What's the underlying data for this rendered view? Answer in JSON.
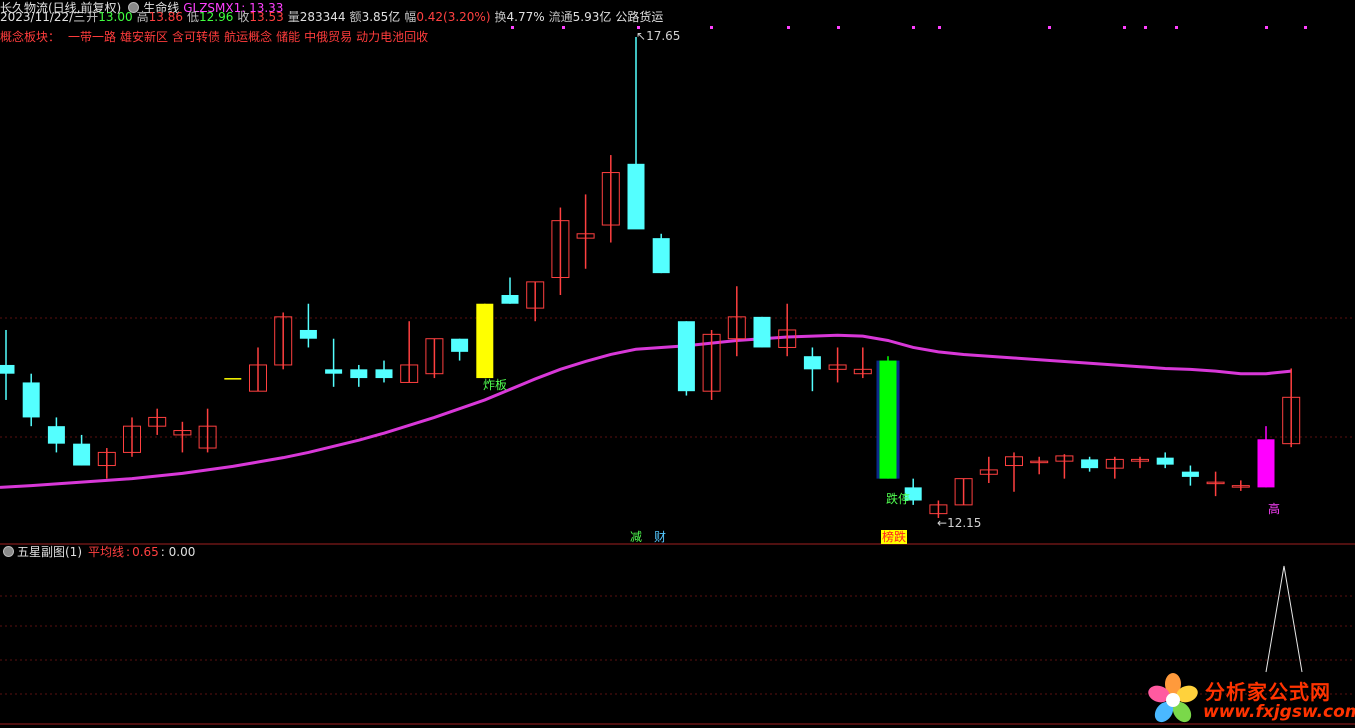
{
  "header": {
    "stock_name": "长久物流(日线,前复权)",
    "indicator_name": "生命线",
    "indicator_value_label": "GLZSMX1: 13.33",
    "date": "2023/11/22/三",
    "open_label": "开",
    "open_value": "13.00",
    "high_label": "高",
    "high_value": "13.86",
    "low_label": "低",
    "low_value": "12.96",
    "close_label": "收",
    "close_value": "13.53",
    "volume_label": "量",
    "volume_value": "283344",
    "amount_label": "额",
    "amount_value": "3.85亿",
    "change_label": "幅",
    "change_value": "0.42(3.20%)",
    "turnover_label": "换",
    "turnover_value": "4.77%",
    "float_label": "流通",
    "float_value": "5.93亿",
    "sector": "公路货运"
  },
  "concepts": {
    "label": "概念板块：",
    "items": [
      "一带一路",
      "雄安新区",
      "含可转债",
      "航运概念",
      "储能",
      "中俄贸易",
      "动力电池回收"
    ]
  },
  "annotations": {
    "high_price": "17.65",
    "low_price": "12.15",
    "zhaban": "炸板",
    "dieting": "跌停",
    "jian": "减",
    "cai": "财",
    "bangdie": "榜跌",
    "gao": "高"
  },
  "sub_chart": {
    "title": "五星副图(1)",
    "ma_label": "平均线",
    "ma_value": "0.65",
    "value2": ": 0.00"
  },
  "logo": {
    "title": "分析家公式网",
    "url": "www.fxjgsw.com"
  },
  "colors": {
    "up": "#ff4040",
    "down": "#54ffff",
    "ma_line": "#d838d8",
    "limit_up": "#ffff00",
    "limit_down": "#00ff00",
    "gao_candle": "#ff00ff"
  },
  "chart_data": {
    "type": "candlestick",
    "candles": [
      {
        "o": 13.9,
        "h": 14.3,
        "l": 13.5,
        "c": 13.8
      },
      {
        "o": 13.7,
        "h": 13.8,
        "l": 13.2,
        "c": 13.3
      },
      {
        "o": 13.2,
        "h": 13.3,
        "l": 12.9,
        "c": 13.0
      },
      {
        "o": 13.0,
        "h": 13.1,
        "l": 12.75,
        "c": 12.75
      },
      {
        "o": 12.75,
        "h": 12.95,
        "l": 12.6,
        "c": 12.9
      },
      {
        "o": 12.9,
        "h": 13.3,
        "l": 12.85,
        "c": 13.2
      },
      {
        "o": 13.2,
        "h": 13.4,
        "l": 13.1,
        "c": 13.3
      },
      {
        "o": 13.1,
        "h": 13.25,
        "l": 12.9,
        "c": 13.15
      },
      {
        "o": 12.95,
        "h": 13.4,
        "l": 12.9,
        "c": 13.2
      },
      {
        "o": 13.75,
        "h": 13.75,
        "l": 13.75,
        "c": 13.75,
        "color": "limit_up"
      },
      {
        "o": 13.6,
        "h": 14.1,
        "l": 13.6,
        "c": 13.9
      },
      {
        "o": 13.9,
        "h": 14.5,
        "l": 13.85,
        "c": 14.45
      },
      {
        "o": 14.3,
        "h": 14.6,
        "l": 14.1,
        "c": 14.2
      },
      {
        "o": 13.85,
        "h": 14.2,
        "l": 13.65,
        "c": 13.8
      },
      {
        "o": 13.85,
        "h": 13.9,
        "l": 13.65,
        "c": 13.75
      },
      {
        "o": 13.85,
        "h": 13.95,
        "l": 13.7,
        "c": 13.75
      },
      {
        "o": 13.7,
        "h": 14.4,
        "l": 13.7,
        "c": 13.9
      },
      {
        "o": 13.8,
        "h": 14.2,
        "l": 13.75,
        "c": 14.2
      },
      {
        "o": 14.2,
        "h": 14.2,
        "l": 13.95,
        "c": 14.05
      },
      {
        "o": 14.6,
        "h": 14.6,
        "l": 13.75,
        "c": 13.75,
        "color": "limit_up",
        "wick": "limit_up"
      },
      {
        "o": 14.7,
        "h": 14.9,
        "l": 14.6,
        "c": 14.6
      },
      {
        "o": 14.55,
        "h": 14.85,
        "l": 14.4,
        "c": 14.85
      },
      {
        "o": 14.9,
        "h": 15.7,
        "l": 14.7,
        "c": 15.55
      },
      {
        "o": 15.35,
        "h": 15.85,
        "l": 15.0,
        "c": 15.4
      },
      {
        "o": 15.5,
        "h": 16.3,
        "l": 15.3,
        "c": 16.1
      },
      {
        "o": 16.2,
        "h": 17.65,
        "l": 15.5,
        "c": 15.45
      },
      {
        "o": 15.35,
        "h": 15.4,
        "l": 14.95,
        "c": 14.95
      },
      {
        "o": 14.4,
        "h": 14.4,
        "l": 13.55,
        "c": 13.6
      },
      {
        "o": 13.6,
        "h": 14.3,
        "l": 13.5,
        "c": 14.25
      },
      {
        "o": 14.2,
        "h": 14.8,
        "l": 14.0,
        "c": 14.45
      },
      {
        "o": 14.45,
        "h": 14.45,
        "l": 14.1,
        "c": 14.1
      },
      {
        "o": 14.1,
        "h": 14.6,
        "l": 14.0,
        "c": 14.3
      },
      {
        "o": 14.0,
        "h": 14.1,
        "l": 13.6,
        "c": 13.85
      },
      {
        "o": 13.85,
        "h": 14.1,
        "l": 13.7,
        "c": 13.9
      },
      {
        "o": 13.8,
        "h": 14.1,
        "l": 13.75,
        "c": 13.85
      },
      {
        "o": 13.95,
        "h": 14.0,
        "l": 12.6,
        "c": 12.6,
        "color": "limit_down"
      },
      {
        "o": 12.5,
        "h": 12.6,
        "l": 12.3,
        "c": 12.35
      },
      {
        "o": 12.2,
        "h": 12.35,
        "l": 12.15,
        "c": 12.3
      },
      {
        "o": 12.3,
        "h": 12.6,
        "l": 12.3,
        "c": 12.6
      },
      {
        "o": 12.65,
        "h": 12.85,
        "l": 12.55,
        "c": 12.7
      },
      {
        "o": 12.75,
        "h": 12.9,
        "l": 12.45,
        "c": 12.85
      },
      {
        "o": 12.8,
        "h": 12.85,
        "l": 12.65,
        "c": 12.8
      },
      {
        "o": 12.8,
        "h": 12.88,
        "l": 12.6,
        "c": 12.86
      },
      {
        "o": 12.82,
        "h": 12.85,
        "l": 12.68,
        "c": 12.72
      },
      {
        "o": 12.72,
        "h": 12.85,
        "l": 12.6,
        "c": 12.82
      },
      {
        "o": 12.8,
        "h": 12.85,
        "l": 12.72,
        "c": 12.82
      },
      {
        "o": 12.84,
        "h": 12.9,
        "l": 12.72,
        "c": 12.76
      },
      {
        "o": 12.68,
        "h": 12.75,
        "l": 12.52,
        "c": 12.62
      },
      {
        "o": 12.56,
        "h": 12.68,
        "l": 12.4,
        "c": 12.56
      },
      {
        "o": 12.52,
        "h": 12.58,
        "l": 12.46,
        "c": 12.52
      },
      {
        "o": 12.5,
        "h": 13.2,
        "l": 12.5,
        "c": 13.05,
        "color": "gao_candle"
      },
      {
        "o": 13.0,
        "h": 13.86,
        "l": 12.96,
        "c": 13.53
      }
    ],
    "ma_line": [
      12.5,
      12.52,
      12.54,
      12.56,
      12.58,
      12.6,
      12.63,
      12.66,
      12.7,
      12.74,
      12.79,
      12.84,
      12.9,
      12.97,
      13.04,
      13.12,
      13.21,
      13.3,
      13.4,
      13.5,
      13.62,
      13.74,
      13.85,
      13.94,
      14.02,
      14.08,
      14.1,
      14.12,
      14.15,
      14.18,
      14.2,
      14.22,
      14.23,
      14.24,
      14.23,
      14.18,
      14.1,
      14.05,
      14.02,
      14.0,
      13.98,
      13.96,
      13.94,
      13.92,
      13.9,
      13.88,
      13.86,
      13.85,
      13.83,
      13.8,
      13.8,
      13.83
    ],
    "sub_series": [
      0,
      0,
      0,
      0,
      0,
      0,
      0,
      0,
      0,
      0,
      0,
      0,
      0,
      0,
      0,
      0,
      0,
      0,
      0,
      0,
      0,
      0,
      0,
      0,
      0,
      0,
      0,
      0,
      0,
      0,
      0,
      0,
      0,
      0,
      0,
      0,
      0,
      0,
      0,
      0,
      0,
      0,
      0,
      0,
      0,
      0,
      0,
      0,
      0,
      0,
      1,
      0
    ]
  }
}
